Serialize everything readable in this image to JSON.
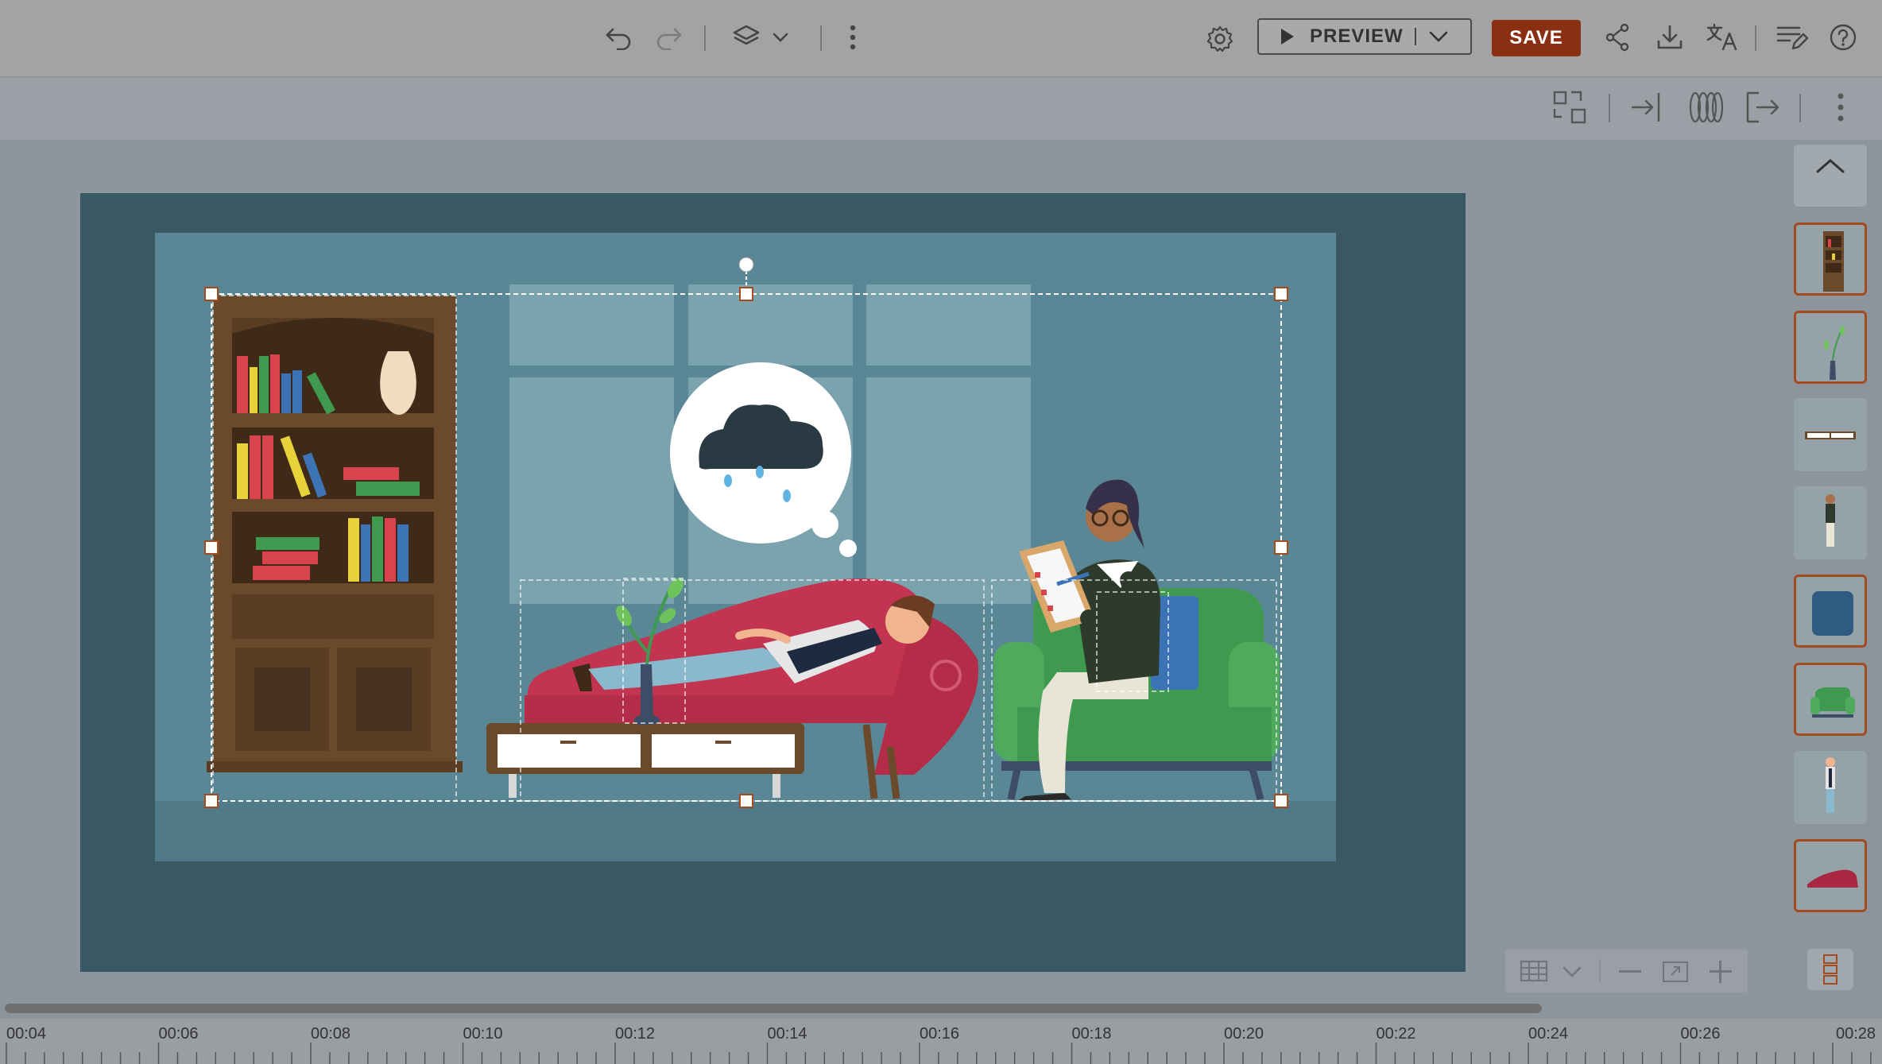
{
  "toolbar": {
    "preview_label": "PREVIEW",
    "save_label": "SAVE"
  },
  "icons": {
    "undo": "undo-icon",
    "redo": "redo-icon",
    "layers": "layers-icon",
    "more": "more-vertical-icon",
    "settings": "gear-icon",
    "share": "share-icon",
    "download": "download-icon",
    "translate": "translate-icon",
    "notes": "notes-edit-icon",
    "help": "help-icon"
  },
  "timeline": {
    "ticks": [
      "00:04",
      "00:06",
      "00:08",
      "00:10",
      "00:12",
      "00:14",
      "00:16",
      "00:18",
      "00:20",
      "00:22",
      "00:24",
      "00:26",
      "00:28"
    ]
  },
  "colors": {
    "accent": "#8b2f12",
    "selection": "#a34a1f"
  }
}
